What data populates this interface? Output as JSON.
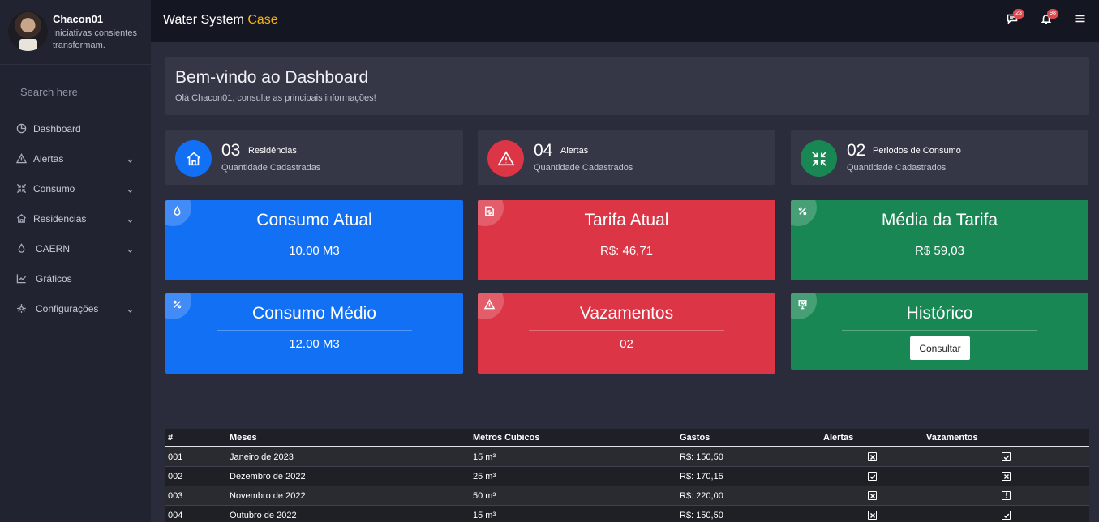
{
  "profile": {
    "name": "Chacon01",
    "tagline": "Iniciativas consientes transformam."
  },
  "search": {
    "placeholder": "Search here"
  },
  "nav": [
    {
      "label": "Dashboard",
      "icon": "dashboard-icon"
    },
    {
      "label": "Alertas",
      "icon": "warning-icon"
    },
    {
      "label": "Consumo",
      "icon": "compress-icon"
    },
    {
      "label": "Residencias",
      "icon": "home-icon"
    },
    {
      "label": "CAERN",
      "icon": "drop-icon"
    },
    {
      "label": "Gráficos",
      "icon": "chart-line-icon"
    },
    {
      "label": "Configurações",
      "icon": "gear-icon"
    }
  ],
  "topbar": {
    "brand_main": "Water System",
    "brand_accent": "Case",
    "messages_count": "23",
    "notifications_count": "98"
  },
  "welcome": {
    "title": "Bem-vindo ao Dashboard",
    "subtitle": "Olá Chacon01, consulte as principais informações!"
  },
  "stats": [
    {
      "number": "03",
      "label": "Residências",
      "sub": "Quantidade Cadastradas",
      "color": "#1270f5",
      "icon": "house-icon"
    },
    {
      "number": "04",
      "label": "Alertas",
      "sub": "Quantidade Cadastrados",
      "color": "#dc3545",
      "icon": "warning-icon"
    },
    {
      "number": "02",
      "label": "Periodos de Consumo",
      "sub": "Quantidade Cadastrados",
      "color": "#198754",
      "icon": "compress-arrows-icon"
    }
  ],
  "cards": {
    "consumo_atual": {
      "title": "Consumo Atual",
      "value": "10.00 M3"
    },
    "tarifa_atual": {
      "title": "Tarifa Atual",
      "value": "R$: 46,71"
    },
    "media_tarifa": {
      "title": "Média da Tarifa",
      "value": "R$ 59,03"
    },
    "consumo_medio": {
      "title": "Consumo Médio",
      "value": "12.00 M3"
    },
    "vazamentos": {
      "title": "Vazamentos",
      "value": "02"
    },
    "historico": {
      "title": "Histórico",
      "button": "Consultar"
    }
  },
  "table": {
    "headers": [
      "#",
      "Meses",
      "Metros Cubicos",
      "Gastos",
      "Alertas",
      "Vazamentos"
    ],
    "rows": [
      {
        "id": "001",
        "mes": "Janeiro de 2023",
        "metros": "15 m³",
        "gastos": "R$: 150,50",
        "alertas": "x",
        "vazamentos": "check"
      },
      {
        "id": "002",
        "mes": "Dezembro de 2022",
        "metros": "25 m³",
        "gastos": "R$: 170,15",
        "alertas": "check",
        "vazamentos": "x"
      },
      {
        "id": "003",
        "mes": "Novembro de 2022",
        "metros": "50 m³",
        "gastos": "R$: 220,00",
        "alertas": "x",
        "vazamentos": "!"
      },
      {
        "id": "004",
        "mes": "Outubro de 2022",
        "metros": "15 m³",
        "gastos": "R$: 150,50",
        "alertas": "x",
        "vazamentos": "check"
      }
    ]
  }
}
